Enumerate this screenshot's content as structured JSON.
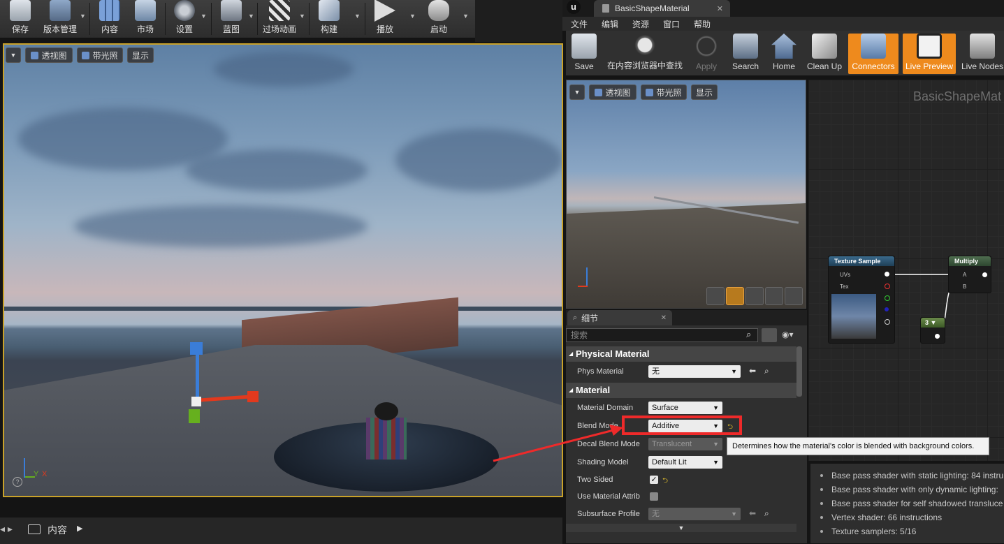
{
  "left_toolbar": {
    "buttons": [
      {
        "label": "保存"
      },
      {
        "label": "版本管理"
      },
      {
        "label": "内容"
      },
      {
        "label": "市场"
      },
      {
        "label": "设置"
      },
      {
        "label": "蓝图"
      },
      {
        "label": "过场动画"
      },
      {
        "label": "构建"
      },
      {
        "label": "播放"
      },
      {
        "label": "启动"
      }
    ]
  },
  "viewport": {
    "buttons": {
      "perspective": "透视图",
      "lit": "带光照",
      "show": "显示"
    },
    "axis": {
      "y": "Y",
      "x": "X"
    }
  },
  "bottom_bar": {
    "folder": "内容"
  },
  "material_editor": {
    "tab_title": "BasicShapeMaterial",
    "menu": [
      "文件",
      "编辑",
      "资源",
      "窗口",
      "帮助"
    ],
    "toolbar": [
      {
        "label": "Save"
      },
      {
        "label": "在内容浏览器中查找"
      },
      {
        "label": "Apply"
      },
      {
        "label": "Search"
      },
      {
        "label": "Home"
      },
      {
        "label": "Clean Up"
      },
      {
        "label": "Connectors"
      },
      {
        "label": "Live Preview"
      },
      {
        "label": "Live Nodes"
      }
    ],
    "preview_buttons": {
      "perspective": "透视图",
      "lit": "带光照",
      "show": "显示"
    }
  },
  "details": {
    "tab": "细节",
    "search_placeholder": "搜索",
    "sections": {
      "physical": "Physical Material",
      "material": "Material"
    },
    "props": {
      "phys_material": {
        "label": "Phys Material",
        "value": "无"
      },
      "material_domain": {
        "label": "Material Domain",
        "value": "Surface"
      },
      "blend_mode": {
        "label": "Blend Mode",
        "value": "Additive"
      },
      "decal_blend_mode": {
        "label": "Decal Blend Mode",
        "value": "Translucent"
      },
      "shading_model": {
        "label": "Shading Model",
        "value": "Default Lit"
      },
      "two_sided": {
        "label": "Two Sided",
        "checked": "✓"
      },
      "use_material_attrib": {
        "label": "Use Material Attrib"
      },
      "subsurface_profile": {
        "label": "Subsurface Profile",
        "value": "无"
      }
    }
  },
  "graph": {
    "title": "BasicShapeMat",
    "texture_node": {
      "title": "Texture Sample",
      "pins": [
        "UVs",
        "Tex"
      ]
    },
    "multiply_node": {
      "title": "Multiply",
      "pins": [
        "A",
        "B"
      ]
    },
    "constant_node": {
      "value": "3"
    }
  },
  "tooltip": "Determines how the material's color is blended with background colors.",
  "stats": [
    "Base pass shader with static lighting: 84 instru",
    "Base pass shader with only dynamic lighting:",
    "Base pass shader for self shadowed transluce",
    "Vertex shader: 66 instructions",
    "Texture samplers: 5/16"
  ],
  "colors": {
    "accent_orange": "#ee8a1d",
    "highlight_red": "#ee2a2a",
    "viewport_border": "#c9a229"
  }
}
